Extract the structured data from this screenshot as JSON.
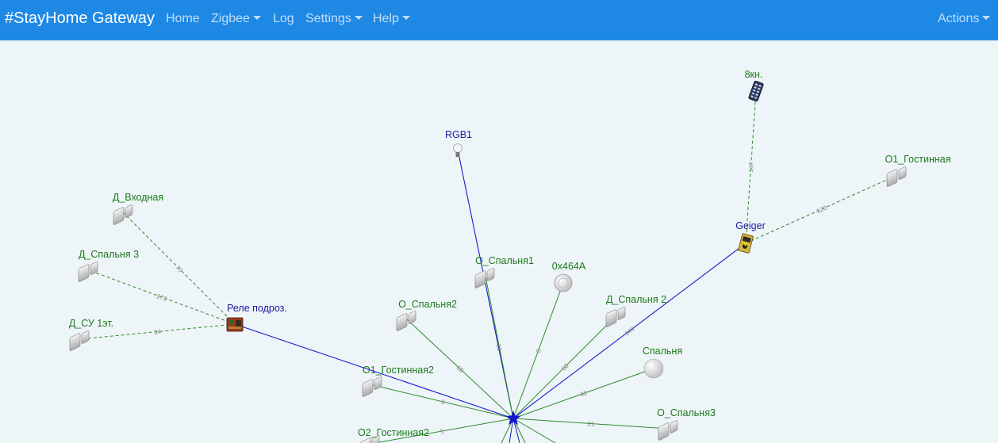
{
  "navbar": {
    "brand": "#StayHome Gateway",
    "items": [
      {
        "label": "Home",
        "dropdown": false
      },
      {
        "label": "Zigbee",
        "dropdown": true
      },
      {
        "label": "Log",
        "dropdown": false
      },
      {
        "label": "Settings",
        "dropdown": true
      },
      {
        "label": "Help",
        "dropdown": true
      }
    ],
    "actions": {
      "label": "Actions",
      "dropdown": true
    }
  },
  "colors": {
    "navbar": "#1e88e5",
    "background": "#eef5f8",
    "router_link": "#1a1acc",
    "enddevice_link": "#2e8b2e",
    "router_label": "#1a1aa0",
    "enddevice_label": "#1a7a1a",
    "coordinator": "#1515d0"
  },
  "map": {
    "coordinator": {
      "icon": "star-icon"
    },
    "nodes": [
      {
        "id": "rgb1",
        "label": "RGB1",
        "kind": "router",
        "icon": "bulb-icon"
      },
      {
        "id": "8kn",
        "label": "8кн.",
        "kind": "enddevice",
        "icon": "remote-icon"
      },
      {
        "id": "o1g_top",
        "label": "O1_Гостинная",
        "kind": "enddevice",
        "icon": "door-sensor-icon"
      },
      {
        "id": "geiger",
        "label": "Geiger",
        "kind": "router",
        "icon": "geiger-icon"
      },
      {
        "id": "d_vh",
        "label": "Д_Входная",
        "kind": "enddevice",
        "icon": "door-sensor-icon"
      },
      {
        "id": "d_sp3",
        "label": "Д_Спальня 3",
        "kind": "enddevice",
        "icon": "door-sensor-icon"
      },
      {
        "id": "d_su",
        "label": "Д_СУ 1эт.",
        "kind": "enddevice",
        "icon": "door-sensor-icon"
      },
      {
        "id": "rele",
        "label": "Реле подроз.",
        "kind": "router",
        "icon": "relay-icon"
      },
      {
        "id": "o_sp1",
        "label": "O_Спальня1",
        "kind": "enddevice",
        "icon": "door-sensor-icon"
      },
      {
        "id": "x464a",
        "label": "0x464A",
        "kind": "enddevice",
        "icon": "round-sensor-icon"
      },
      {
        "id": "o_sp2",
        "label": "O_Спальня2",
        "kind": "enddevice",
        "icon": "door-sensor-icon"
      },
      {
        "id": "d_sp2",
        "label": "Д_Спальня 2",
        "kind": "enddevice",
        "icon": "door-sensor-icon"
      },
      {
        "id": "spal",
        "label": "Спальня",
        "kind": "enddevice",
        "icon": "sphere-sensor-icon"
      },
      {
        "id": "o1g",
        "label": "O1_Гостинная2",
        "kind": "enddevice",
        "icon": "door-sensor-icon"
      },
      {
        "id": "o_sp3",
        "label": "O_Спальня3",
        "kind": "enddevice",
        "icon": "door-sensor-icon"
      },
      {
        "id": "o2g",
        "label": "O2_Гостинная2",
        "kind": "enddevice",
        "icon": "door-sensor-icon"
      }
    ],
    "links": [
      {
        "from": "coord",
        "to": "rgb1",
        "type": "router",
        "label": ""
      },
      {
        "from": "coord",
        "to": "geiger",
        "type": "router",
        "label": "149"
      },
      {
        "from": "coord",
        "to": "rele",
        "type": "router",
        "label": ""
      },
      {
        "from": "coord",
        "to": "o_sp1",
        "type": "direct",
        "label": "18"
      },
      {
        "from": "coord",
        "to": "x464a",
        "type": "direct",
        "label": "0"
      },
      {
        "from": "coord",
        "to": "o_sp2",
        "type": "direct",
        "label": "68"
      },
      {
        "from": "coord",
        "to": "d_sp2",
        "type": "direct",
        "label": "60"
      },
      {
        "from": "coord",
        "to": "spal",
        "type": "direct",
        "label": "42"
      },
      {
        "from": "coord",
        "to": "o1g",
        "type": "direct",
        "label": "0"
      },
      {
        "from": "coord",
        "to": "o_sp3",
        "type": "direct",
        "label": "21"
      },
      {
        "from": "coord",
        "to": "o2g",
        "type": "direct",
        "label": "5"
      },
      {
        "from": "geiger",
        "to": "8kn",
        "type": "child",
        "label": "147"
      },
      {
        "from": "geiger",
        "to": "o1g_top",
        "type": "child",
        "label": "120"
      },
      {
        "from": "rele",
        "to": "d_vh",
        "type": "child",
        "label": "70"
      },
      {
        "from": "rele",
        "to": "d_sp3",
        "type": "child",
        "label": "173"
      },
      {
        "from": "rele",
        "to": "d_su",
        "type": "child",
        "label": "34"
      }
    ]
  }
}
